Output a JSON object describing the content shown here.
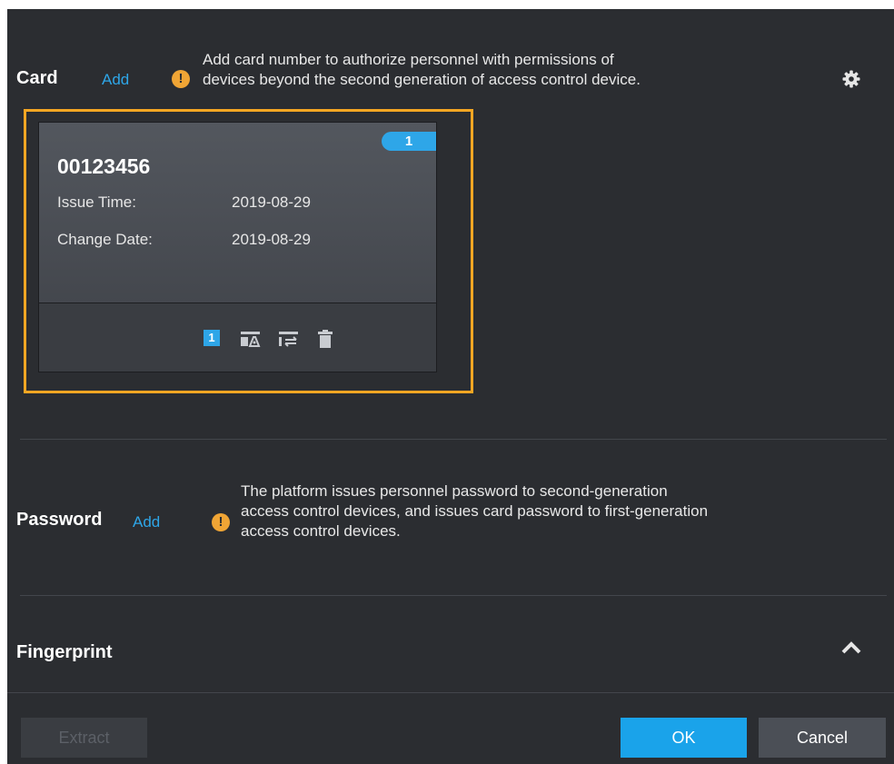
{
  "card_section": {
    "title": "Card",
    "add_label": "Add",
    "info_mark": "!",
    "hint_lines": [
      "Add card number to authorize personnel with permissions of",
      "devices beyond the second generation of access control device."
    ],
    "settings_icon": "gear-icon"
  },
  "card": {
    "badge": "1",
    "number": "00123456",
    "issue_time_label": "Issue Time:",
    "issue_time_value": "2019-08-29",
    "change_date_label": "Change Date:",
    "change_date_value": "2019-08-29",
    "actions": {
      "card_index": "1",
      "icons": [
        "card-number-icon",
        "card-permission-icon",
        "card-replace-icon",
        "trash-icon"
      ]
    },
    "highlight_color": "#f5a623"
  },
  "password_section": {
    "title": "Password",
    "add_label": "Add",
    "info_mark": "!",
    "hint_lines": [
      "The platform issues personnel password to second-generation",
      "access control devices, and issues card password to first-generation",
      "access control devices."
    ]
  },
  "fingerprint_section": {
    "title": "Fingerprint",
    "expand_icon": "chevron-up-icon"
  },
  "footer": {
    "extract_label": "Extract",
    "ok_label": "OK",
    "cancel_label": "Cancel"
  },
  "colors": {
    "accent": "#1aa3ea",
    "panel_bg": "#2b2d31",
    "warning": "#f0a535",
    "highlight": "#f5a623"
  }
}
